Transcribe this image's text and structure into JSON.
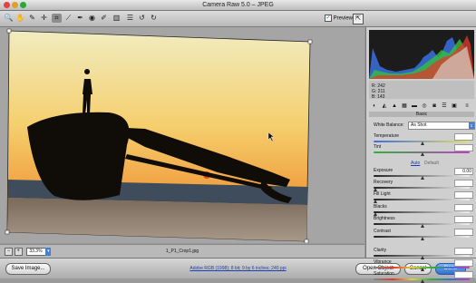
{
  "window": {
    "title": "Camera Raw 5.0  –  JPEG"
  },
  "toolbar": {
    "tools": [
      {
        "name": "zoom-tool-icon",
        "glyph": "🔍"
      },
      {
        "name": "hand-tool-icon",
        "glyph": "✋"
      },
      {
        "name": "white-balance-tool-icon",
        "glyph": "✎"
      },
      {
        "name": "color-sampler-tool-icon",
        "glyph": "✛"
      },
      {
        "name": "crop-tool-icon",
        "glyph": "⌗"
      },
      {
        "name": "straighten-tool-icon",
        "glyph": "⟋"
      },
      {
        "name": "spot-removal-tool-icon",
        "glyph": "✒"
      },
      {
        "name": "red-eye-tool-icon",
        "glyph": "◉"
      },
      {
        "name": "adjustment-brush-icon",
        "glyph": "✐"
      },
      {
        "name": "graduated-filter-icon",
        "glyph": "▥"
      },
      {
        "name": "preferences-icon",
        "glyph": "☰"
      },
      {
        "name": "rotate-left-icon",
        "glyph": "↺"
      },
      {
        "name": "rotate-right-icon",
        "glyph": "↻"
      }
    ],
    "preview_label": "Preview",
    "preview_checked": true
  },
  "status": {
    "zoom_value": "33.3%",
    "filename": "1_P1_Crop1.jpg"
  },
  "bottom": {
    "save_label": "Save Image...",
    "workflow_label": "Adobe RGB (1998); 8 bit; 9 by 6 inches; 240 ppi",
    "open_label": "Open Object",
    "cancel_label": "Cancel",
    "done_label": "Done"
  },
  "panel": {
    "rgb": {
      "r": "R:  242",
      "g": "G:  211",
      "b": "B:  143"
    },
    "section_title": "Basic",
    "white_balance_label": "White Balance:",
    "white_balance_value": "As Shot",
    "auto_label": "Auto",
    "default_label": "Default",
    "sliders": [
      {
        "label": "Temperature",
        "value": "",
        "pos": 0.5,
        "kind": "temp"
      },
      {
        "label": "Tint",
        "value": "",
        "pos": 0.5,
        "kind": "tint"
      },
      {
        "label": "Exposure",
        "value": "0.00",
        "pos": 0.5,
        "kind": "gray"
      },
      {
        "label": "Recovery",
        "value": "",
        "pos": 0.0,
        "kind": "gray"
      },
      {
        "label": "Fill Light",
        "value": "",
        "pos": 0.0,
        "kind": "gray"
      },
      {
        "label": "Blacks",
        "value": "",
        "pos": 0.0,
        "kind": "gray"
      },
      {
        "label": "Brightness",
        "value": "",
        "pos": 0.5,
        "kind": "gray"
      },
      {
        "label": "Contrast",
        "value": "",
        "pos": 0.5,
        "kind": "gray"
      },
      {
        "label": "Clarity",
        "value": "",
        "pos": 0.5,
        "kind": "gray"
      },
      {
        "label": "Vibrance",
        "value": "",
        "pos": 0.5,
        "kind": "vib"
      },
      {
        "label": "Saturation",
        "value": "",
        "pos": 0.5,
        "kind": "sat"
      }
    ]
  },
  "colors": {
    "accent": "#2f6fd0",
    "sky_top": "#f3e6b0",
    "sky_mid": "#f2b24d",
    "sun": "#e8431c",
    "sea": "#3d4d5e"
  }
}
